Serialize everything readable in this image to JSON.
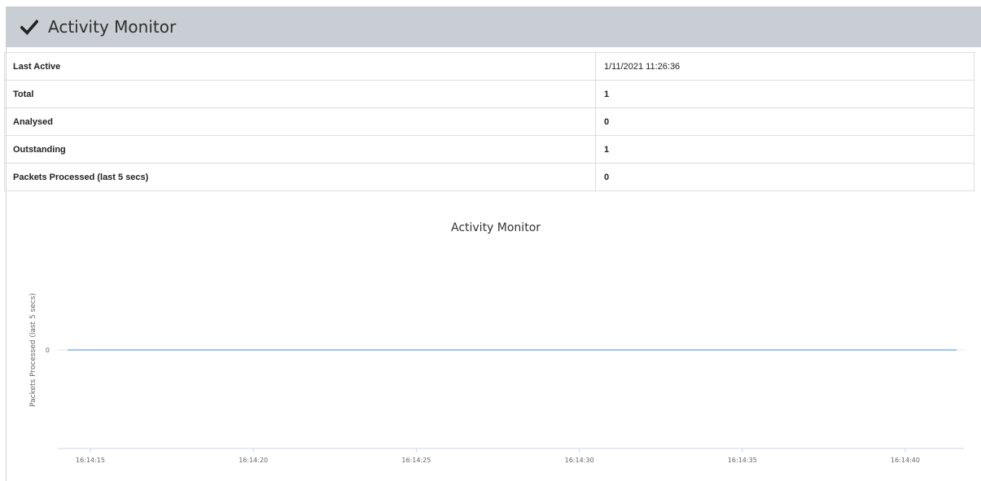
{
  "header": {
    "title": "Activity Monitor",
    "icon": "checkmark-icon"
  },
  "stats": [
    {
      "label": "Last Active",
      "value": "1/11/2021 11:26:36"
    },
    {
      "label": "Total",
      "value": "1"
    },
    {
      "label": "Analysed",
      "value": "0"
    },
    {
      "label": "Outstanding",
      "value": "1"
    },
    {
      "label": "Packets Processed (last 5 secs)",
      "value": "0"
    }
  ],
  "chart_data": {
    "type": "line",
    "title": "Activity Monitor",
    "xlabel": "",
    "ylabel": "Packets Processed (last 5 secs)",
    "x_ticks": [
      "16:14:15",
      "16:14:20",
      "16:14:25",
      "16:14:30",
      "16:14:35",
      "16:14:40"
    ],
    "y_ticks": [
      "0"
    ],
    "x": [
      "16:14:14",
      "16:14:41"
    ],
    "series": [
      {
        "values": [
          0,
          0
        ],
        "color": "#7cb5ec"
      }
    ],
    "grid": true
  }
}
